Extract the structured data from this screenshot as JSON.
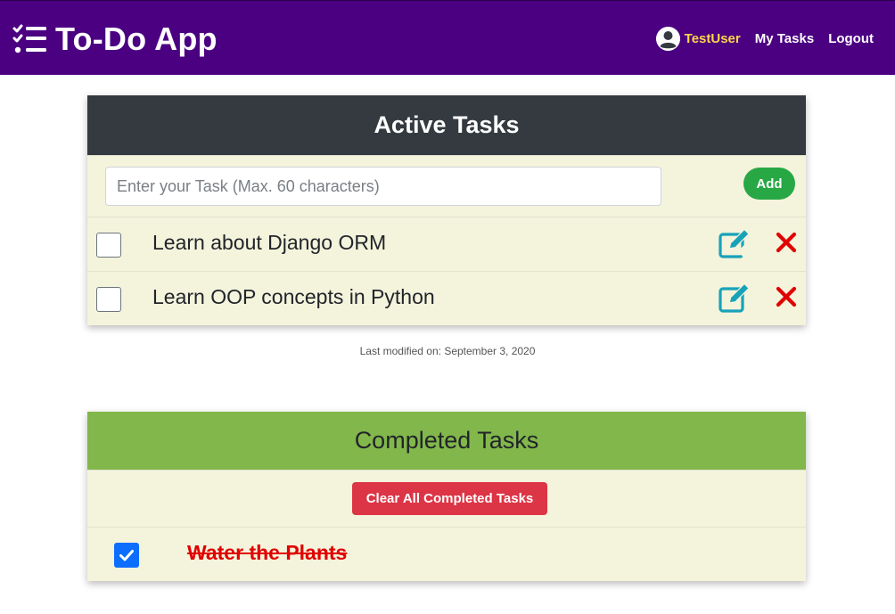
{
  "nav": {
    "brand": "To-Do App",
    "username": "TestUser",
    "my_tasks": "My Tasks",
    "logout": "Logout",
    "bg_color": "#4b0082",
    "user_color": "#ffd54a"
  },
  "active": {
    "title": "Active Tasks",
    "input_placeholder": "Enter your Task (Max. 60 characters)",
    "input_value": "",
    "add_label": "Add",
    "tasks": [
      {
        "text": "Learn about Django ORM",
        "checked": false
      },
      {
        "text": "Learn OOP concepts in Python",
        "checked": false
      }
    ]
  },
  "modified": "Last modified on: September 3, 2020",
  "completed": {
    "title": "Completed Tasks",
    "clear_label": "Clear All Completed Tasks",
    "tasks": [
      {
        "text": "Water the Plants",
        "checked": true
      }
    ]
  },
  "icons": {
    "brand": "tasks-list-icon",
    "avatar": "user-circle-icon",
    "edit": "edit-icon",
    "delete": "close-icon",
    "check": "check-icon"
  },
  "colors": {
    "active_header": "#343a40",
    "completed_header": "#82b74b",
    "card_bg": "#f4f3dc",
    "add_button": "#28a745",
    "clear_button": "#dc3545",
    "edit_icon": "#17a2b8",
    "delete_icon": "#e00000",
    "checkbox_checked": "#0d6efd"
  }
}
